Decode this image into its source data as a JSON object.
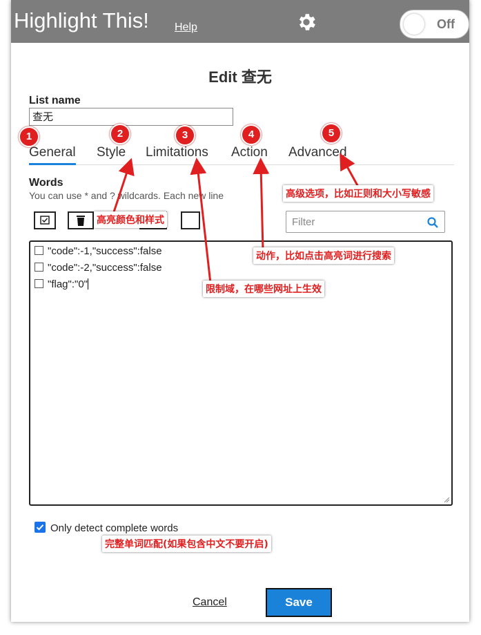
{
  "header": {
    "app_title": "Highlight This!",
    "help_label": "Help",
    "settings_icon": "gear-icon",
    "toggle_label": "Off"
  },
  "editor": {
    "title": "Edit 查无",
    "list_name_label": "List name",
    "list_name_value": "查无"
  },
  "tabs": [
    {
      "label": "General",
      "active": true
    },
    {
      "label": "Style"
    },
    {
      "label": "Limitations"
    },
    {
      "label": "Action"
    },
    {
      "label": "Advanced"
    }
  ],
  "words": {
    "label": "Words",
    "help": "You can use * and ? wildcards. Each new line",
    "filter_placeholder": "Filter",
    "items": [
      "\"code\":-1,\"success\":false",
      "\"code\":-2,\"success\":false",
      "\"flag\":\"0\""
    ]
  },
  "options": {
    "complete_words_label": "Only detect complete words",
    "complete_words_checked": true
  },
  "footer": {
    "cancel_label": "Cancel",
    "save_label": "Save"
  },
  "annotations": {
    "badges": [
      "1",
      "2",
      "3",
      "4",
      "5"
    ],
    "style_note": "高亮颜色和样式",
    "limitations_note": "限制域，在哪些网址上生效",
    "action_note": "动作，比如点击高亮词进行搜索",
    "advanced_note": "高级选项，比如正则和大小写敏感",
    "complete_note": "完整单词匹配(如果包含中文不要开启)"
  },
  "colors": {
    "header_bg": "#7d7d7d",
    "accent": "#1a82d8",
    "annotation_red": "#e02020"
  }
}
